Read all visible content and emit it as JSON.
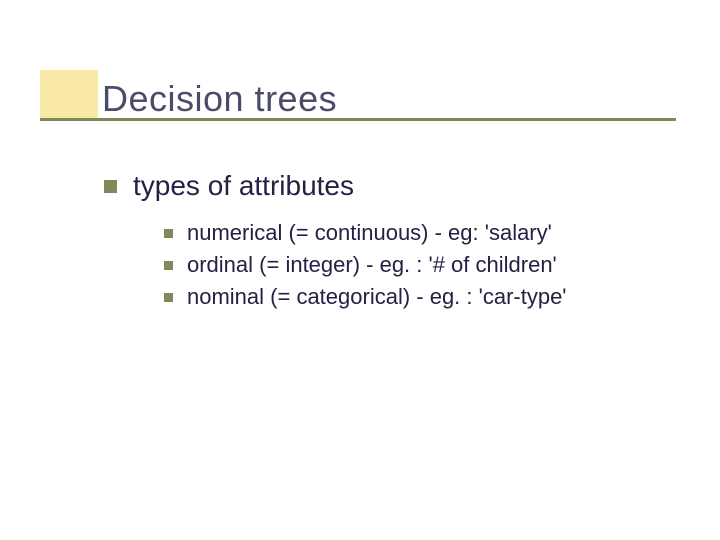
{
  "slide": {
    "title": "Decision trees",
    "level1": {
      "text": "types of attributes"
    },
    "level2": [
      {
        "text": "numerical (= continuous) - eg: 'salary'"
      },
      {
        "text": "ordinal (= integer) - eg. : '# of children'"
      },
      {
        "text": "nominal (= categorical) - eg. : 'car-type'"
      }
    ]
  }
}
